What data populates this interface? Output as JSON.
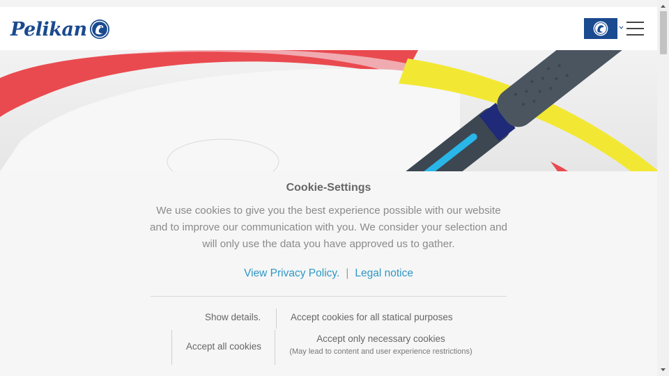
{
  "header": {
    "logo_text": "Pelikan",
    "language_button_icon": "pelikan-emblem-icon",
    "menu_icon": "hamburger-menu-icon"
  },
  "cookie": {
    "title": "Cookie-Settings",
    "description": "We use cookies to give you the best experience possible with our website and to improve our communication with you. We consider your selection and will only use the data you have approved us to gather.",
    "privacy_link": "View Privacy Policy.",
    "separator": "|",
    "legal_link": "Legal notice",
    "show_details": "Show details.",
    "accept_statistical": "Accept cookies for all statical purposes",
    "accept_all": "Accept all cookies",
    "accept_necessary": "Accept only necessary cookies",
    "accept_necessary_note": "(May lead to content and user experience restrictions)"
  },
  "colors": {
    "brand_blue": "#1a4a8f",
    "link_blue": "#2e97c4",
    "hero_red": "#e94a4f",
    "hero_yellow": "#f2e834",
    "pen_gray": "#3d4752",
    "pen_accent": "#29b6e8"
  }
}
